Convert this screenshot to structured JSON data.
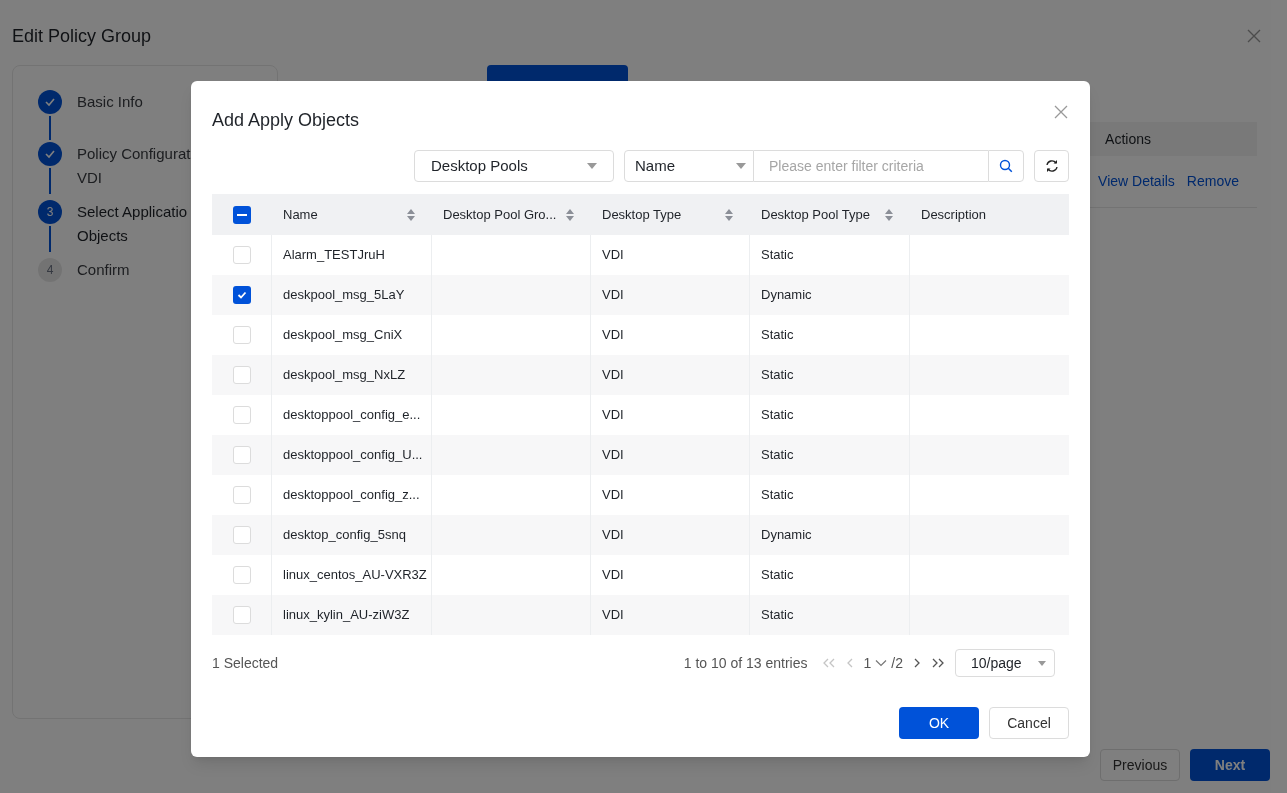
{
  "page": {
    "title": "Edit Policy Group",
    "steps": [
      {
        "label": "Basic Info",
        "completed": true,
        "selected": false
      },
      {
        "label": "Policy Configurat",
        "sublabel": "VDI",
        "completed": true,
        "selected": false
      },
      {
        "number": "3",
        "label": "Select Applicatio",
        "sublabel": "Objects",
        "completed": false,
        "selected": true
      },
      {
        "number": "4",
        "label": "Confirm",
        "completed": false,
        "selected": false
      }
    ],
    "table_header": "Actions",
    "row_links": [
      "View Details",
      "Remove"
    ],
    "footer_buttons": [
      {
        "label": "Previous",
        "primary": false
      },
      {
        "label": "Next",
        "primary": true
      }
    ]
  },
  "dialog": {
    "title": "Add Apply Objects",
    "type_select": "Desktop Pools",
    "field_select": "Name",
    "search": {
      "placeholder": "Please enter filter criteria"
    },
    "select_all": {
      "indeterminate": true
    },
    "columns": [
      {
        "label": "Name",
        "sortable": true
      },
      {
        "label": "Desktop Pool Gro...",
        "sortable": true
      },
      {
        "label": "Desktop Type",
        "sortable": true
      },
      {
        "label": "Desktop Pool Type",
        "sortable": true
      },
      {
        "label": "Description",
        "sortable": false
      }
    ],
    "rows": [
      {
        "checked": false,
        "cells": [
          "Alarm_TESTJruH",
          "",
          "VDI",
          "Static",
          ""
        ]
      },
      {
        "checked": true,
        "cells": [
          "deskpool_msg_5LaY",
          "",
          "VDI",
          "Dynamic",
          ""
        ]
      },
      {
        "checked": false,
        "cells": [
          "deskpool_msg_CniX",
          "",
          "VDI",
          "Static",
          ""
        ]
      },
      {
        "checked": false,
        "cells": [
          "deskpool_msg_NxLZ",
          "",
          "VDI",
          "Static",
          ""
        ]
      },
      {
        "checked": false,
        "cells": [
          "desktoppool_config_e...",
          "",
          "VDI",
          "Static",
          ""
        ]
      },
      {
        "checked": false,
        "cells": [
          "desktoppool_config_U...",
          "",
          "VDI",
          "Static",
          ""
        ]
      },
      {
        "checked": false,
        "cells": [
          "desktoppool_config_z...",
          "",
          "VDI",
          "Static",
          ""
        ]
      },
      {
        "checked": false,
        "cells": [
          "desktop_config_5snq",
          "",
          "VDI",
          "Dynamic",
          ""
        ]
      },
      {
        "checked": false,
        "cells": [
          "linux_centos_AU-VXR3Z",
          "",
          "VDI",
          "Static",
          ""
        ]
      },
      {
        "checked": false,
        "cells": [
          "linux_kylin_AU-ziW3Z",
          "",
          "VDI",
          "Static",
          ""
        ]
      }
    ],
    "selected_count": "1 Selected",
    "entries": "1 to 10 of 13 entries",
    "current_page": "1",
    "total_pages": "/2",
    "page_size": "10/page",
    "buttons": [
      {
        "label": "OK",
        "primary": true
      },
      {
        "label": "Cancel",
        "primary": false
      }
    ]
  }
}
